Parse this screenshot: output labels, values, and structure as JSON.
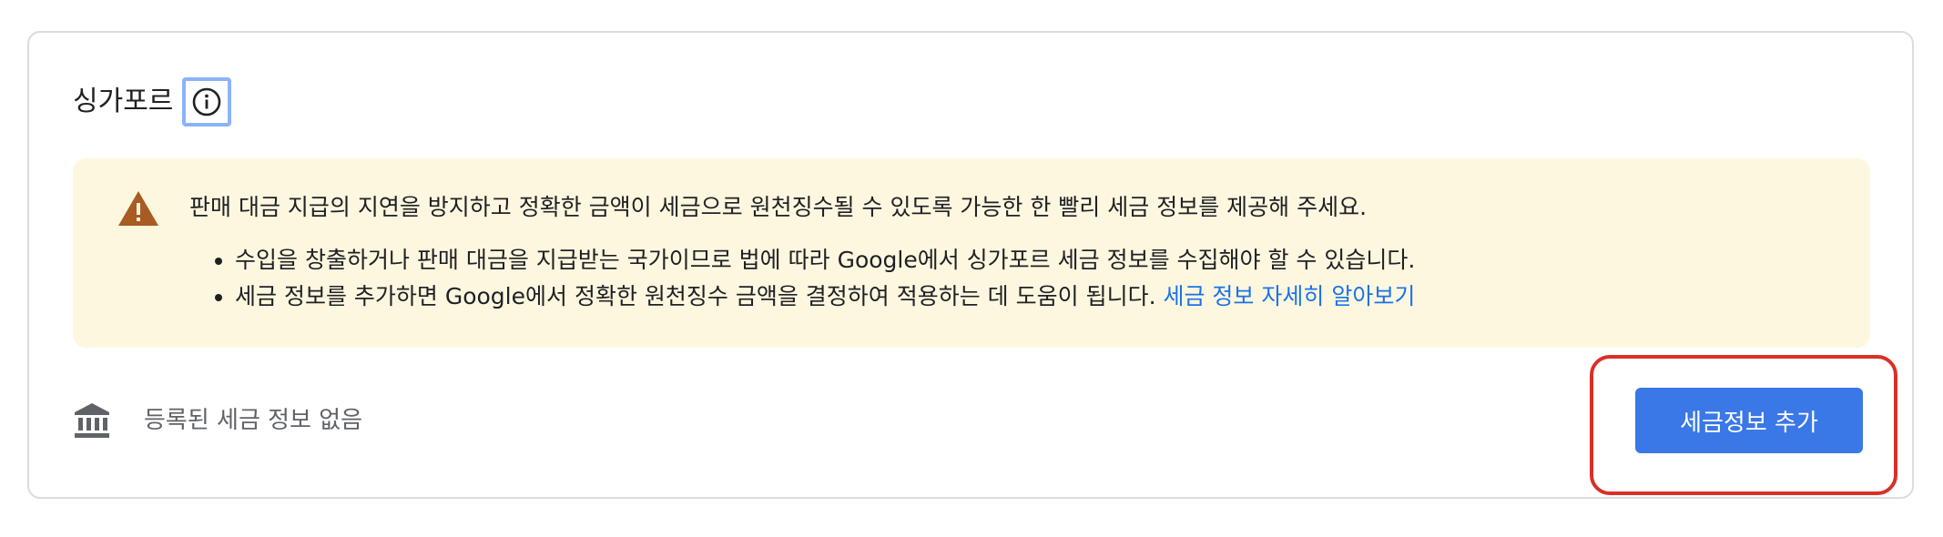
{
  "section": {
    "country_title": "싱가포르",
    "info_icon": "info-circle-icon"
  },
  "warning": {
    "icon": "warning-triangle-icon",
    "accent_color": "#a85c21",
    "message": "판매 대금 지급의 지연을 방지하고 정확한 금액이 세금으로 원천징수될 수 있도록 가능한 한 빨리 세금 정보를 제공해 주세요.",
    "bullets": [
      {
        "text": "수입을 창출하거나 판매 대금을 지급받는 국가이므로 법에 따라 Google에서 싱가포르 세금 정보를 수집해야 할 수 있습니다."
      },
      {
        "text": "세금 정보를 추가하면 Google에서 정확한 원천징수 금액을 결정하여 적용하는 데 도움이 됩니다. ",
        "link": "세금 정보 자세히 알아보기"
      }
    ]
  },
  "status": {
    "icon": "bank-icon",
    "text": "등록된 세금 정보 없음"
  },
  "actions": {
    "add_tax_info_label": "세금정보 추가",
    "button_color": "#3b78e7",
    "highlight_color": "#d93025"
  }
}
